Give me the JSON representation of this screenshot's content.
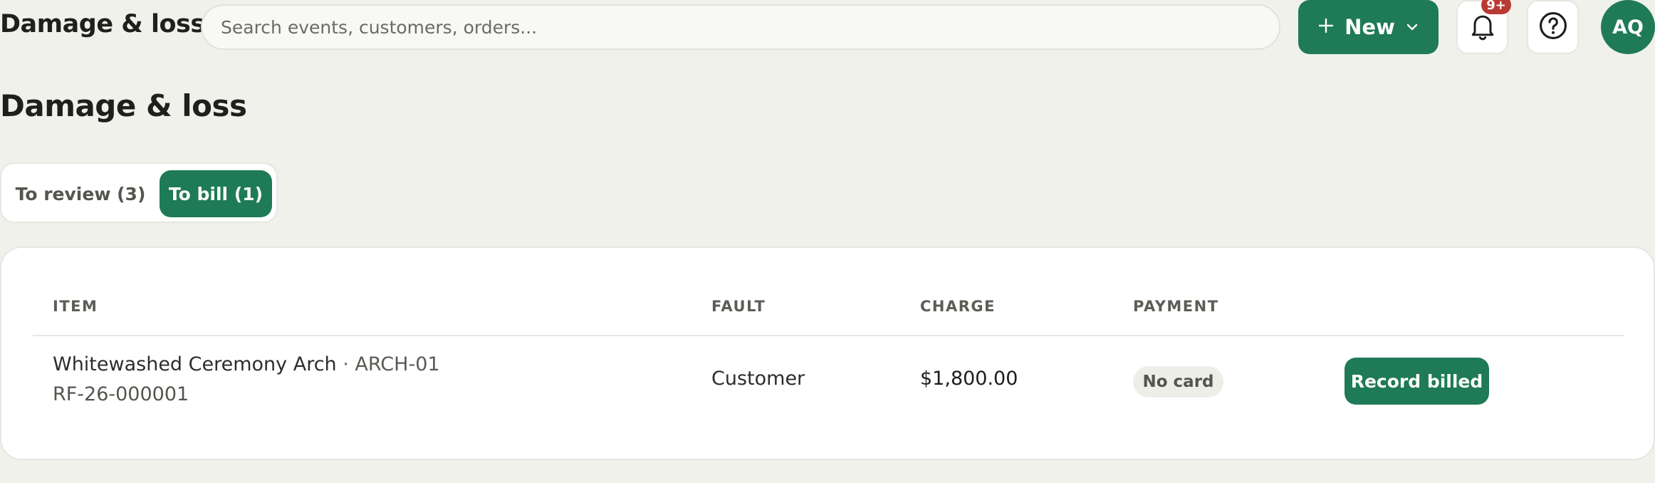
{
  "app": {
    "title": "Damage & loss"
  },
  "search": {
    "placeholder": "Search events, customers, orders..."
  },
  "header": {
    "new_label": "New",
    "notifications_badge": "9+",
    "avatar_initials": "AQ"
  },
  "page": {
    "title": "Damage & loss"
  },
  "tabs": [
    {
      "label": "To review (3)",
      "active": false
    },
    {
      "label": "To bill (1)",
      "active": true
    }
  ],
  "table": {
    "columns": [
      "ITEM",
      "FAULT",
      "CHARGE",
      "PAYMENT"
    ],
    "rows": [
      {
        "item_name": "Whitewashed Ceremony Arch",
        "separator": " · ",
        "item_code": "ARCH-01",
        "reference": "RF-26-000001",
        "fault": "Customer",
        "charge": "$1,800.00",
        "payment": "No card",
        "action_label": "Record billed"
      }
    ]
  },
  "colors": {
    "accent": "#1f7a57",
    "background": "#f1f1ec",
    "badge_alert": "#b93a32"
  },
  "icons": {
    "new": "plus-icon",
    "new_dropdown": "chevron-down-icon",
    "notifications": "bell-icon",
    "help": "help-circle-icon"
  }
}
